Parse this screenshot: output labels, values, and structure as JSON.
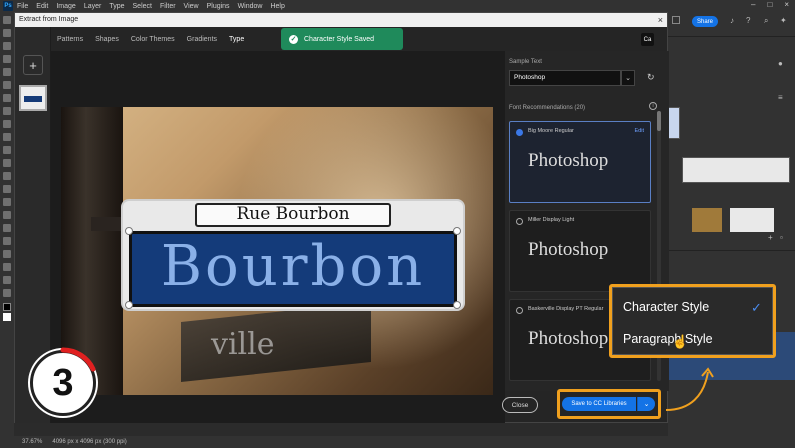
{
  "app": {
    "logo": "Ps",
    "menu": [
      "File",
      "Edit",
      "Image",
      "Layer",
      "Type",
      "Select",
      "Filter",
      "View",
      "Plugins",
      "Window",
      "Help"
    ],
    "window_controls": [
      "–",
      "□",
      "×"
    ],
    "share_label": "Share",
    "status": {
      "zoom": "37.67%",
      "doc_info": "4096 px x 4096 px (300 ppi)"
    }
  },
  "dialog": {
    "title": "Extract from Image",
    "close_icon": "×",
    "add_label": "+",
    "tabs": [
      {
        "label": "Patterns",
        "active": false
      },
      {
        "label": "Shapes",
        "active": false
      },
      {
        "label": "Color Themes",
        "active": false
      },
      {
        "label": "Gradients",
        "active": false
      },
      {
        "label": "Type",
        "active": true
      }
    ],
    "toast": {
      "text": "Character Style Saved",
      "icon": "check-circle-icon",
      "color": "#1f8a5b"
    },
    "ca_label": "Ca",
    "photo": {
      "sign_top_text": "Rue Bourbon",
      "sign_main_text": "Bourbon",
      "arm_text": "ville",
      "sign_color": "#143b7a"
    },
    "step_badge": "3",
    "fonts": {
      "sample_label": "Sample Text",
      "sample_value": "Photoshop",
      "recommendations_label": "Font Recommendations (20)",
      "items": [
        {
          "name": "Big Moore Regular",
          "preview": "Photoshop",
          "selected": true,
          "edit_label": "Edit"
        },
        {
          "name": "Miller Display Light",
          "preview": "Photoshop",
          "selected": false
        },
        {
          "name": "Baskerville Display PT Regular",
          "preview": "Photoshop",
          "selected": false
        }
      ]
    },
    "footer": {
      "close_label": "Close",
      "save_label": "Save to CC Libraries",
      "save_dropdown_icon": "chevron-down-icon"
    }
  },
  "style_menu": {
    "items": [
      {
        "label": "Character Style",
        "checked": true
      },
      {
        "label": "Paragraph Style",
        "checked": false
      }
    ],
    "highlight_color": "#f0a01e"
  }
}
